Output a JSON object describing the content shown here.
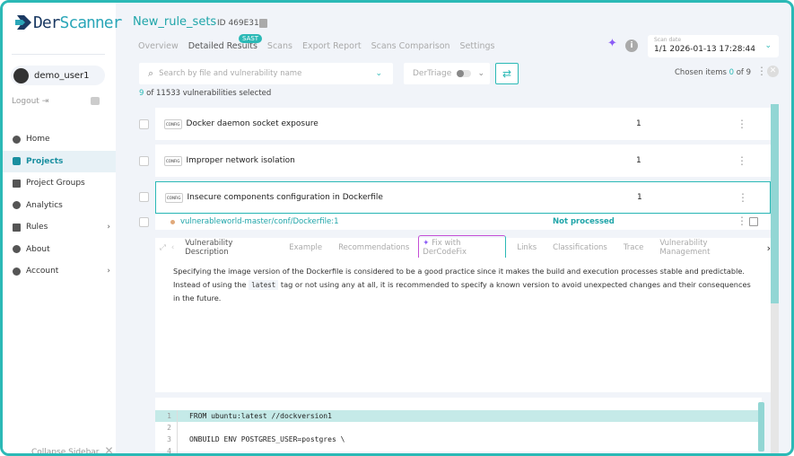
{
  "brand": {
    "name_a": "Der",
    "name_b": "Scanner"
  },
  "user": {
    "name": "demo_user1",
    "logout": "Logout"
  },
  "nav": [
    {
      "label": "Home"
    },
    {
      "label": "Projects",
      "active": true
    },
    {
      "label": "Project Groups"
    },
    {
      "label": "Analytics"
    },
    {
      "label": "Rules",
      "chevron": true
    },
    {
      "label": "About"
    },
    {
      "label": "Account",
      "chevron": true
    }
  ],
  "collapse": "Collapse Sidebar",
  "project": {
    "title": "New_rule_sets",
    "id": "ID 469E31"
  },
  "tabs": [
    "Overview",
    "Detailed Results",
    "Scans",
    "Export Report",
    "Scans Comparison",
    "Settings"
  ],
  "tab_badge": "SAST",
  "scan_date": {
    "label": "Scan date",
    "value": "1/1 2026-01-13 17:28:44"
  },
  "search": {
    "placeholder": "Search by file and vulnerability name"
  },
  "triage": {
    "label": "DerTriage"
  },
  "chosen": {
    "prefix": "Chosen items",
    "count": "0",
    "suffix": "of 9"
  },
  "selection": {
    "count": "9",
    "text": "of  11533 vulnerabilities selected"
  },
  "rows": [
    {
      "icon": "CONFIG",
      "name": "Docker daemon socket exposure",
      "count": "1"
    },
    {
      "icon": "CONFIG",
      "name": "Improper network isolation",
      "count": "1"
    },
    {
      "icon": "CONFIG",
      "name": "Insecure components configuration in Dockerfile",
      "count": "1"
    }
  ],
  "file": {
    "path": "vulnerableworld-master/conf/Dockerfile:1",
    "status": "Not processed"
  },
  "vuln_tabs": {
    "items": [
      "Vulnerability Description",
      "Example",
      "Recommendations"
    ],
    "fix": "Fix with DerCodeFix",
    "items2": [
      "Links",
      "Classifications",
      "Trace",
      "Vulnerability Management"
    ]
  },
  "description": {
    "p1": "Specifying the image version of the Dockerfile is considered to be a good practice since it makes the build and execution processes stable and predictable. Instead of using the",
    "code": "latest",
    "p2": "tag or not using any at all, it is recommended to specify a known version to avoid unexpected changes and their consequences in the future."
  },
  "code_lines": [
    {
      "n": "1",
      "c": "FROM ubuntu:latest //dockversion1"
    },
    {
      "n": "2",
      "c": ""
    },
    {
      "n": "3",
      "c": "ONBUILD ENV POSTGRES_USER=postgres \\"
    },
    {
      "n": "4",
      "c": ""
    }
  ]
}
